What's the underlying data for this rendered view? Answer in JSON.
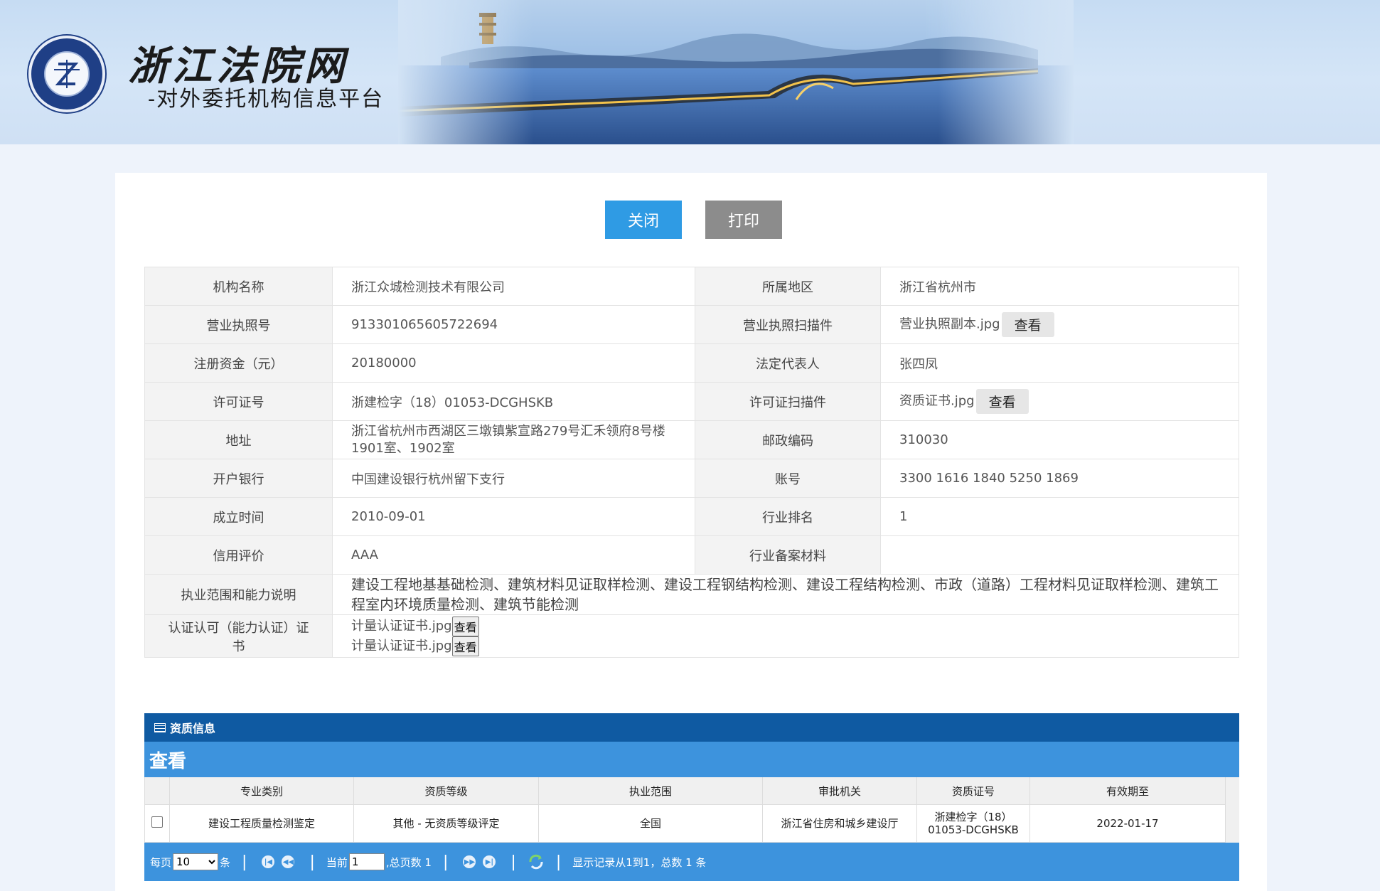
{
  "banner": {
    "title": "浙江法院网",
    "subtitle": "-对外委托机构信息平台",
    "logo_icon": "court-seal-icon"
  },
  "toolbar": {
    "close_label": "关闭",
    "print_label": "打印",
    "colors": {
      "close": "#2f9be4",
      "print": "#8c8c8c"
    }
  },
  "info": {
    "org_name_label": "机构名称",
    "org_name": "浙江众城检测技术有限公司",
    "region_label": "所属地区",
    "region": "浙江省杭州市",
    "license_no_label": "营业执照号",
    "license_no": "913301065605722694",
    "license_scan_label": "营业执照扫描件",
    "license_scan_file": "营业执照副本.jpg",
    "view_label": "查看",
    "capital_label": "注册资金（元）",
    "capital": "20180000",
    "legal_rep_label": "法定代表人",
    "legal_rep": "张四凤",
    "permit_no_label": "许可证号",
    "permit_no": "浙建检字（18）01053-DCGHSKB",
    "permit_scan_label": "许可证扫描件",
    "permit_scan_file": "资质证书.jpg",
    "address_label": "地址",
    "address": "浙江省杭州市西湖区三墩镇紫宣路279号汇禾领府8号楼1901室、1902室",
    "postcode_label": "邮政编码",
    "postcode": "310030",
    "bank_label": "开户银行",
    "bank": "中国建设银行杭州留下支行",
    "account_label": "账号",
    "account": "3300 1616 1840 5250 1869",
    "founded_label": "成立时间",
    "founded": "2010-09-01",
    "rank_label": "行业排名",
    "rank": "1",
    "credit_label": "信用评价",
    "credit": "AAA",
    "filing_label": "行业备案材料",
    "filing": "",
    "scope_label": "执业范围和能力说明",
    "scope": "建设工程地基基础检测、建筑材料见证取样检测、建设工程钢结构检测、建设工程结构检测、市政（道路）工程材料见证取样检测、建筑工程室内环境质量检测、建筑节能检测",
    "cert_label": "认证认可（能力认证）证书",
    "certs": [
      {
        "file": "计量认证证书.jpg",
        "view": "查看"
      },
      {
        "file": "计量认证证书.jpg",
        "view": "查看"
      }
    ]
  },
  "grid": {
    "header_title": "资质信息",
    "sub_title": "查看",
    "columns": [
      "专业类别",
      "资质等级",
      "执业范围",
      "审批机关",
      "资质证号",
      "有效期至"
    ],
    "rows": [
      {
        "category": "建设工程质量检测鉴定",
        "level": "其他 - 无资质等级评定",
        "scope": "全国",
        "authority": "浙江省住房和城乡建设厅",
        "cert_no_line1": "浙建检字（18）",
        "cert_no_line2": "01053-DCGHSKB",
        "valid_until": "2022-01-17"
      }
    ],
    "colors": {
      "header": "#0f5aa2",
      "sub": "#3d93dd"
    }
  },
  "pager": {
    "per_page_label": "每页",
    "per_page_value": "10",
    "per_page_unit": "条",
    "current_label": "当前",
    "current_page": "1",
    "total_pages_label": ",总页数 1",
    "summary": "显示记录从1到1，总数 1 条"
  }
}
